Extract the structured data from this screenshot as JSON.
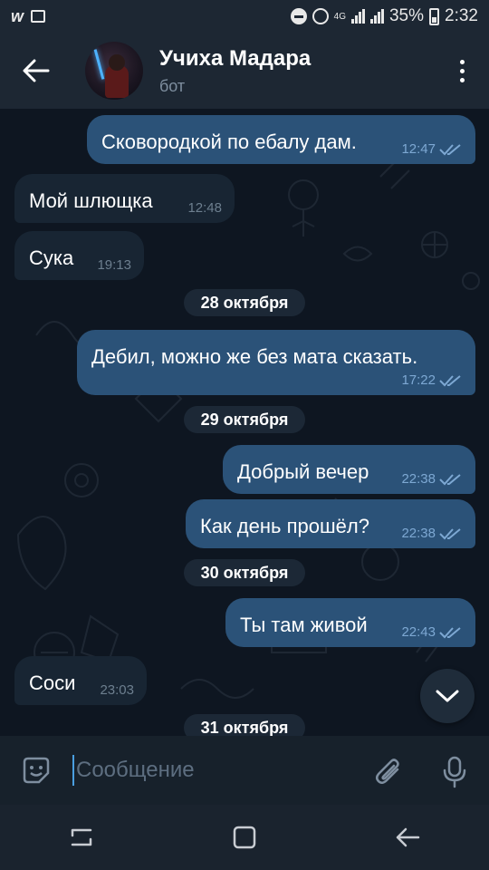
{
  "status_bar": {
    "network": "4G",
    "battery": "35%",
    "time": "2:32"
  },
  "header": {
    "title": "Учиха Мадара",
    "subtitle": "бот"
  },
  "messages": [
    {
      "dir": "out",
      "text": "Сковородкой по ебалу дам.",
      "time": "12:47"
    },
    {
      "dir": "in",
      "text": "Мой шлющка",
      "time": "12:48"
    },
    {
      "dir": "in",
      "text": "Сука",
      "time": "19:13"
    },
    {
      "dir": "out",
      "text": "Дебил, можно же без мата сказать.",
      "time": "17:22"
    },
    {
      "dir": "out",
      "text": "Добрый вечер",
      "time": "22:38"
    },
    {
      "dir": "out",
      "text": "Как день прошёл?",
      "time": "22:38"
    },
    {
      "dir": "out",
      "text": "Ты там живой",
      "time": "22:43"
    },
    {
      "dir": "in",
      "text": "Соси",
      "time": "23:03"
    }
  ],
  "dates": [
    "28 октября",
    "29 октября",
    "30 октября",
    "31 октября"
  ],
  "composer": {
    "placeholder": "Сообщение"
  },
  "icons": {
    "back": "arrow-left-icon",
    "menu": "more-vertical-icon",
    "emoji": "sticker-icon",
    "attach": "paperclip-icon",
    "mic": "microphone-icon",
    "scroll": "chevron-down-icon",
    "read": "double-check-icon"
  },
  "colors": {
    "header_bg": "#1d2733",
    "chat_bg": "#0e1621",
    "outgoing_bubble": "#2b5278",
    "incoming_bubble": "#182533",
    "accent": "#4a9fe0"
  }
}
